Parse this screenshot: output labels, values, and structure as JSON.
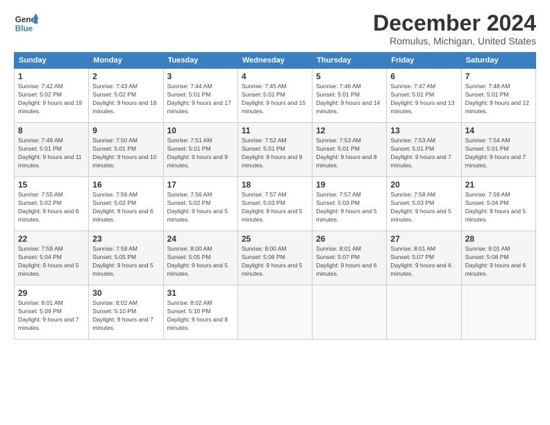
{
  "logo": {
    "line1": "General",
    "line2": "Blue"
  },
  "header": {
    "month": "December 2024",
    "location": "Romulus, Michigan, United States"
  },
  "weekdays": [
    "Sunday",
    "Monday",
    "Tuesday",
    "Wednesday",
    "Thursday",
    "Friday",
    "Saturday"
  ],
  "weeks": [
    [
      {
        "day": "1",
        "sunrise": "7:42 AM",
        "sunset": "5:02 PM",
        "daylight": "9 hours and 19 minutes."
      },
      {
        "day": "2",
        "sunrise": "7:43 AM",
        "sunset": "5:02 PM",
        "daylight": "9 hours and 18 minutes."
      },
      {
        "day": "3",
        "sunrise": "7:44 AM",
        "sunset": "5:01 PM",
        "daylight": "9 hours and 17 minutes."
      },
      {
        "day": "4",
        "sunrise": "7:45 AM",
        "sunset": "5:01 PM",
        "daylight": "9 hours and 15 minutes."
      },
      {
        "day": "5",
        "sunrise": "7:46 AM",
        "sunset": "5:01 PM",
        "daylight": "9 hours and 14 minutes."
      },
      {
        "day": "6",
        "sunrise": "7:47 AM",
        "sunset": "5:01 PM",
        "daylight": "9 hours and 13 minutes."
      },
      {
        "day": "7",
        "sunrise": "7:48 AM",
        "sunset": "5:01 PM",
        "daylight": "9 hours and 12 minutes."
      }
    ],
    [
      {
        "day": "8",
        "sunrise": "7:49 AM",
        "sunset": "5:01 PM",
        "daylight": "9 hours and 11 minutes."
      },
      {
        "day": "9",
        "sunrise": "7:50 AM",
        "sunset": "5:01 PM",
        "daylight": "9 hours and 10 minutes."
      },
      {
        "day": "10",
        "sunrise": "7:51 AM",
        "sunset": "5:01 PM",
        "daylight": "9 hours and 9 minutes."
      },
      {
        "day": "11",
        "sunrise": "7:52 AM",
        "sunset": "5:01 PM",
        "daylight": "9 hours and 9 minutes."
      },
      {
        "day": "12",
        "sunrise": "7:53 AM",
        "sunset": "5:01 PM",
        "daylight": "9 hours and 8 minutes."
      },
      {
        "day": "13",
        "sunrise": "7:53 AM",
        "sunset": "5:01 PM",
        "daylight": "9 hours and 7 minutes."
      },
      {
        "day": "14",
        "sunrise": "7:54 AM",
        "sunset": "5:01 PM",
        "daylight": "9 hours and 7 minutes."
      }
    ],
    [
      {
        "day": "15",
        "sunrise": "7:55 AM",
        "sunset": "5:02 PM",
        "daylight": "9 hours and 6 minutes."
      },
      {
        "day": "16",
        "sunrise": "7:56 AM",
        "sunset": "5:02 PM",
        "daylight": "9 hours and 6 minutes."
      },
      {
        "day": "17",
        "sunrise": "7:56 AM",
        "sunset": "5:02 PM",
        "daylight": "9 hours and 5 minutes."
      },
      {
        "day": "18",
        "sunrise": "7:57 AM",
        "sunset": "5:03 PM",
        "daylight": "9 hours and 5 minutes."
      },
      {
        "day": "19",
        "sunrise": "7:57 AM",
        "sunset": "5:03 PM",
        "daylight": "9 hours and 5 minutes."
      },
      {
        "day": "20",
        "sunrise": "7:58 AM",
        "sunset": "5:03 PM",
        "daylight": "9 hours and 5 minutes."
      },
      {
        "day": "21",
        "sunrise": "7:59 AM",
        "sunset": "5:04 PM",
        "daylight": "9 hours and 5 minutes."
      }
    ],
    [
      {
        "day": "22",
        "sunrise": "7:59 AM",
        "sunset": "5:04 PM",
        "daylight": "9 hours and 5 minutes."
      },
      {
        "day": "23",
        "sunrise": "7:59 AM",
        "sunset": "5:05 PM",
        "daylight": "9 hours and 5 minutes."
      },
      {
        "day": "24",
        "sunrise": "8:00 AM",
        "sunset": "5:05 PM",
        "daylight": "9 hours and 5 minutes."
      },
      {
        "day": "25",
        "sunrise": "8:00 AM",
        "sunset": "5:06 PM",
        "daylight": "9 hours and 5 minutes."
      },
      {
        "day": "26",
        "sunrise": "8:01 AM",
        "sunset": "5:07 PM",
        "daylight": "9 hours and 6 minutes."
      },
      {
        "day": "27",
        "sunrise": "8:01 AM",
        "sunset": "5:07 PM",
        "daylight": "9 hours and 6 minutes."
      },
      {
        "day": "28",
        "sunrise": "8:01 AM",
        "sunset": "5:08 PM",
        "daylight": "9 hours and 6 minutes."
      }
    ],
    [
      {
        "day": "29",
        "sunrise": "8:01 AM",
        "sunset": "5:09 PM",
        "daylight": "9 hours and 7 minutes."
      },
      {
        "day": "30",
        "sunrise": "8:02 AM",
        "sunset": "5:10 PM",
        "daylight": "9 hours and 7 minutes."
      },
      {
        "day": "31",
        "sunrise": "8:02 AM",
        "sunset": "5:10 PM",
        "daylight": "9 hours and 8 minutes."
      },
      null,
      null,
      null,
      null
    ]
  ],
  "labels": {
    "sunrise": "Sunrise:",
    "sunset": "Sunset:",
    "daylight": "Daylight:"
  }
}
